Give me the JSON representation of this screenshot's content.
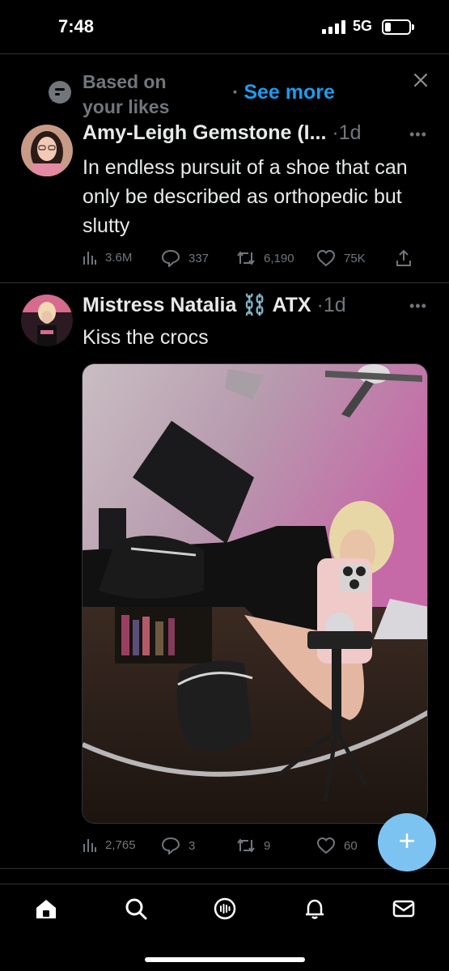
{
  "status_bar": {
    "time": "7:48",
    "network": "5G",
    "battery_level": 0.25
  },
  "recommendation": {
    "label": "Based on your likes",
    "see_more": "See more",
    "icon": "chat-bubble-question-icon",
    "dismiss_icon": "close-icon"
  },
  "tweets": [
    {
      "author_name": "Amy-Leigh Gemstone (I...",
      "age": "1d",
      "text": "In endless pursuit of a shoe that can only be described as orthopedic but slutty",
      "views": "3.6M",
      "replies": "337",
      "retweets": "6,190",
      "likes": "75K"
    },
    {
      "author_name": "Mistress Natalia ⛓️ ATX",
      "age": "1d",
      "text": "Kiss the crocs",
      "media": "mirror selfie photo",
      "views": "2,765",
      "replies": "3",
      "retweets": "9",
      "likes": "60"
    }
  ],
  "fab_icon": "plus-icon",
  "nav": [
    "home-icon",
    "search-icon",
    "spaces-icon",
    "bell-icon",
    "mail-icon"
  ],
  "colors": {
    "background": "#000000",
    "accent": "#1d9bf0",
    "muted": "#71767b",
    "fab": "#7cc3f2"
  }
}
